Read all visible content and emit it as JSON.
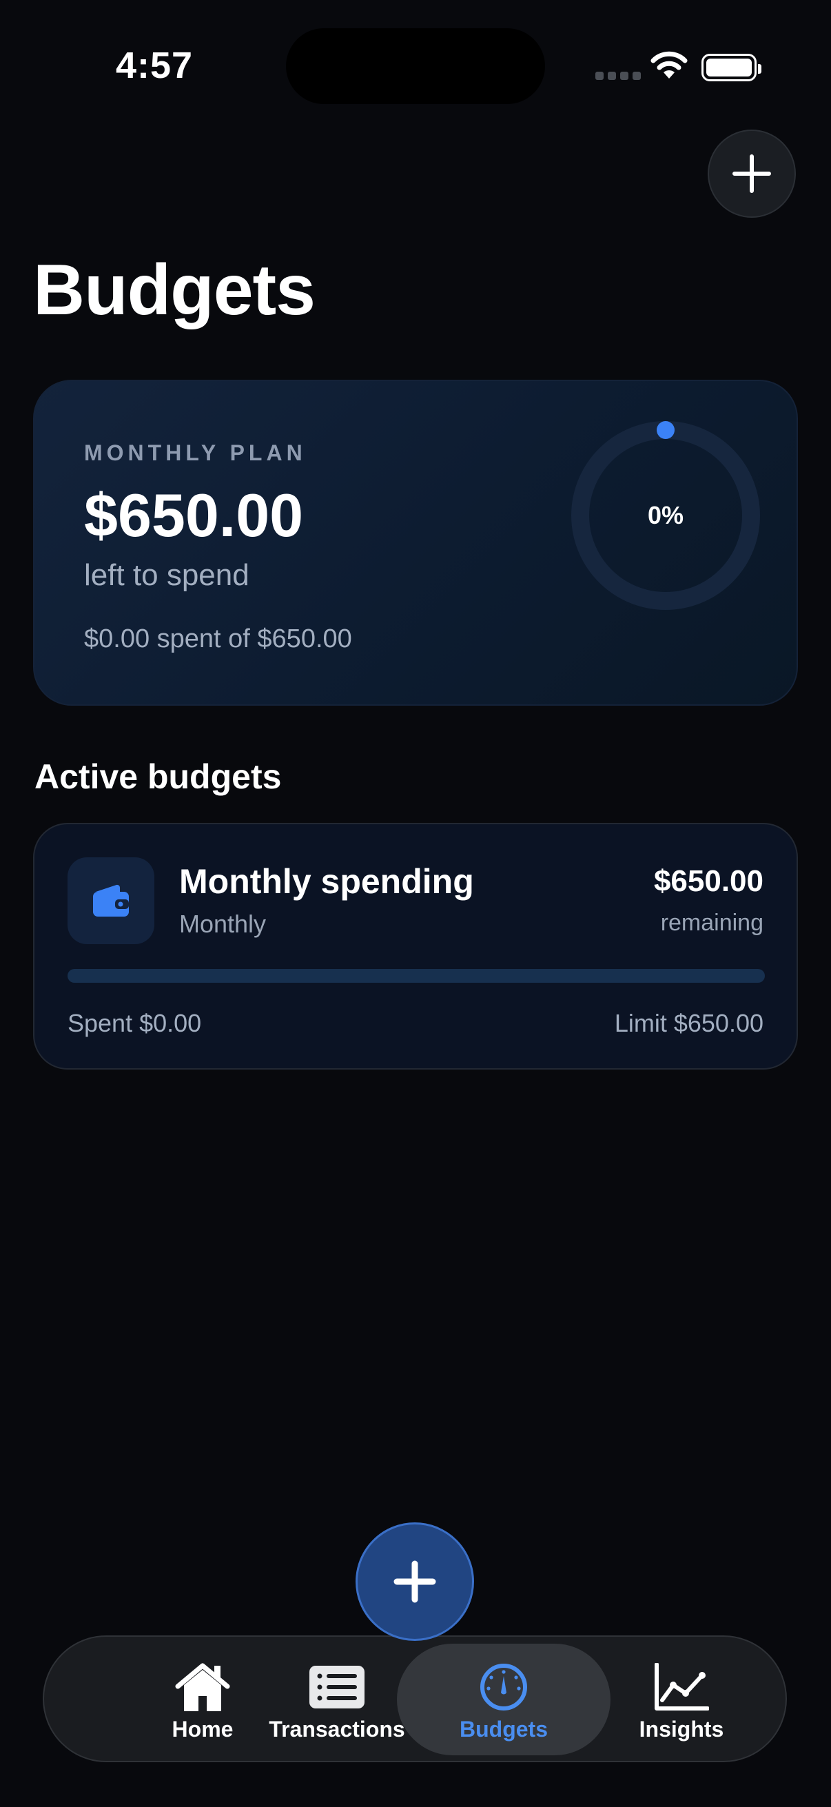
{
  "status_bar": {
    "time": "4:57"
  },
  "header": {
    "title": "Budgets",
    "add_icon": "plus-icon"
  },
  "summary": {
    "eyebrow": "MONTHLY PLAN",
    "amount": "$650.00",
    "subtitle": "left to spend",
    "detail": "$0.00 spent of $650.00",
    "percent_label": "0%",
    "percent_value": 0
  },
  "active_budgets": {
    "title": "Active budgets",
    "items": [
      {
        "icon": "wallet-icon",
        "name": "Monthly spending",
        "period": "Monthly",
        "remaining": "$650.00",
        "remaining_label": "remaining",
        "spent": "Spent $0.00",
        "limit": "Limit $650.00",
        "progress": 0
      }
    ]
  },
  "fab": {
    "icon": "plus-icon"
  },
  "tab_bar": {
    "items": [
      {
        "label": "Home",
        "icon": "house-icon",
        "active": false
      },
      {
        "label": "Transactions",
        "icon": "list-icon",
        "active": false
      },
      {
        "label": "Budgets",
        "icon": "gauge-icon",
        "active": true
      },
      {
        "label": "Insights",
        "icon": "chart-line-icon",
        "active": false
      }
    ]
  },
  "colors": {
    "background": "#08090d",
    "accent": "#3b82f6",
    "active_tab": "#4a8ef0",
    "fab": "#214582"
  }
}
